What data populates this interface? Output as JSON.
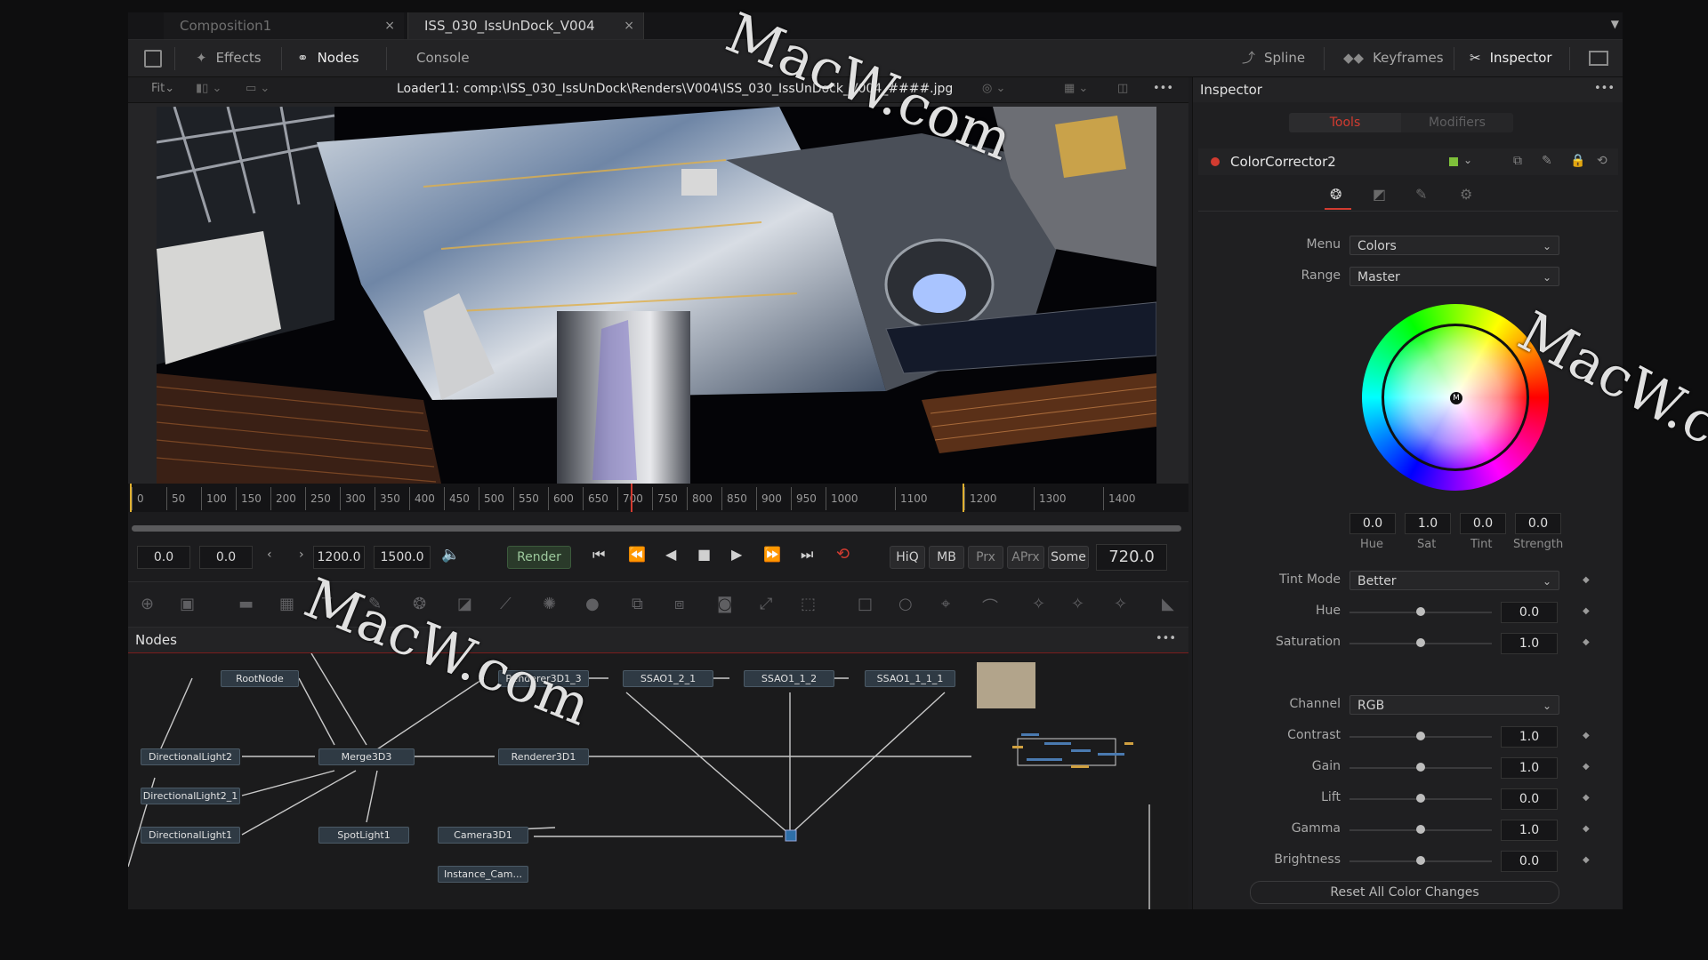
{
  "tabs": [
    {
      "label": "Composition1",
      "close": "×"
    },
    {
      "label": "ISS_030_IssUnDock_V004",
      "close": "×"
    }
  ],
  "toolbar": {
    "effects": "Effects",
    "nodes": "Nodes",
    "console": "Console",
    "spline": "Spline",
    "keyframes": "Keyframes",
    "inspector": "Inspector"
  },
  "viewer": {
    "fit_label": "Fit",
    "path": "Loader11: comp:\\ISS_030_IssUnDock\\Renders\\V004\\ISS_030_IssUnDock_V004_####.jpg",
    "more": "•••"
  },
  "ruler": {
    "ticks": [
      "0",
      "50",
      "100",
      "150",
      "200",
      "250",
      "300",
      "350",
      "400",
      "450",
      "500",
      "550",
      "600",
      "650",
      "700",
      "750",
      "800",
      "850",
      "900",
      "950",
      "1000",
      "1100",
      "1200",
      "1300",
      "1400"
    ]
  },
  "transport": {
    "start_val": "0.0",
    "current_val": "0.0",
    "render_end": "1200.0",
    "global_end": "1500.0",
    "render_button": "Render",
    "hiq": "HiQ",
    "mb": "MB",
    "prx": "Prx",
    "aprx": "APrx",
    "some": "Some",
    "current_frame": "720.0"
  },
  "nodes_panel": {
    "title": "Nodes",
    "more": "•••",
    "nodes": [
      "RootNode",
      "DirectionalLight2",
      "DirectionalLight2_1",
      "DirectionalLight1",
      "Merge3D3",
      "SpotLight1",
      "Camera3D1",
      "Instance_Cam...",
      "Renderer3D1_3",
      "Renderer3D1",
      "SSAO1_2_1",
      "SSAO1_1_2",
      "SSAO1_1_1_1"
    ]
  },
  "inspector": {
    "title": "Inspector",
    "more": "•••",
    "tools_tab": "Tools",
    "modifiers_tab": "Modifiers",
    "tool_name": "ColorCorrector2",
    "menu_label": "Menu",
    "menu_value": "Colors",
    "range_label": "Range",
    "range_value": "Master",
    "wheel_center": "M",
    "wheel_values": [
      {
        "value": "0.0",
        "label": "Hue"
      },
      {
        "value": "1.0",
        "label": "Sat"
      },
      {
        "value": "0.0",
        "label": "Tint"
      },
      {
        "value": "0.0",
        "label": "Strength"
      }
    ],
    "tint_mode_label": "Tint Mode",
    "tint_mode_value": "Better",
    "hue_label": "Hue",
    "hue_value": "0.0",
    "saturation_label": "Saturation",
    "saturation_value": "1.0",
    "channel_label": "Channel",
    "channel_value": "RGB",
    "contrast_label": "Contrast",
    "contrast_value": "1.0",
    "gain_label": "Gain",
    "gain_value": "1.0",
    "lift_label": "Lift",
    "lift_value": "0.0",
    "gamma_label": "Gamma",
    "gamma_value": "1.0",
    "brightness_label": "Brightness",
    "brightness_value": "0.0",
    "reset_button": "Reset All Color Changes"
  },
  "watermarks": [
    "MacW.com",
    "MacW.com",
    "MacW.com"
  ],
  "colors": {
    "accent_red": "#d23b30",
    "node_fill": "#2f3a44",
    "panel_bg": "#1f1f21"
  }
}
